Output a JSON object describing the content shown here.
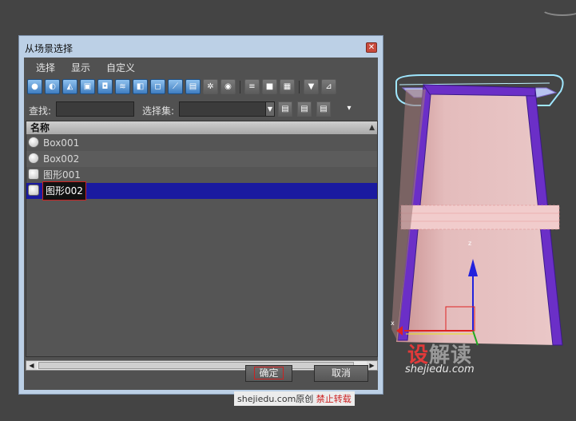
{
  "dialog": {
    "title": "从场景选择",
    "close_glyph": "✕"
  },
  "menu": [
    "选择",
    "显示",
    "自定义"
  ],
  "toolbar": {
    "icons": [
      "geometry-filter-icon",
      "shape-filter-icon",
      "light-filter-icon",
      "camera-filter-icon",
      "helper-filter-icon",
      "spacewarp-filter-icon",
      "group-filter-icon",
      "xref-filter-icon",
      "bone-filter-icon",
      "container-filter-icon",
      "frozen-filter-icon",
      "hidden-filter-icon",
      "list-display-icon",
      "select-all-icon",
      "select-none-icon",
      "filter-icon",
      "filter-options-icon"
    ]
  },
  "filter": {
    "find_label": "查找:",
    "find_value": "",
    "selection_set_label": "选择集:",
    "selection_set_value": ""
  },
  "list": {
    "header": "名称",
    "rows": [
      {
        "name": "Box001",
        "type": "geometry",
        "selected": false
      },
      {
        "name": "Box002",
        "type": "geometry",
        "selected": false
      },
      {
        "name": "图形001",
        "type": "shape",
        "selected": false
      },
      {
        "name": "图形002",
        "type": "shape",
        "selected": true
      }
    ]
  },
  "buttons": {
    "ok": "确定",
    "cancel": "取消"
  },
  "viewport": {
    "axis_z": "z",
    "axis_x": "x"
  },
  "watermark": {
    "logo_a": "设",
    "logo_b": "解读",
    "url": "shejiedu.com",
    "note_site": "shejiedu.com原创",
    "note_red": "禁止转载"
  }
}
